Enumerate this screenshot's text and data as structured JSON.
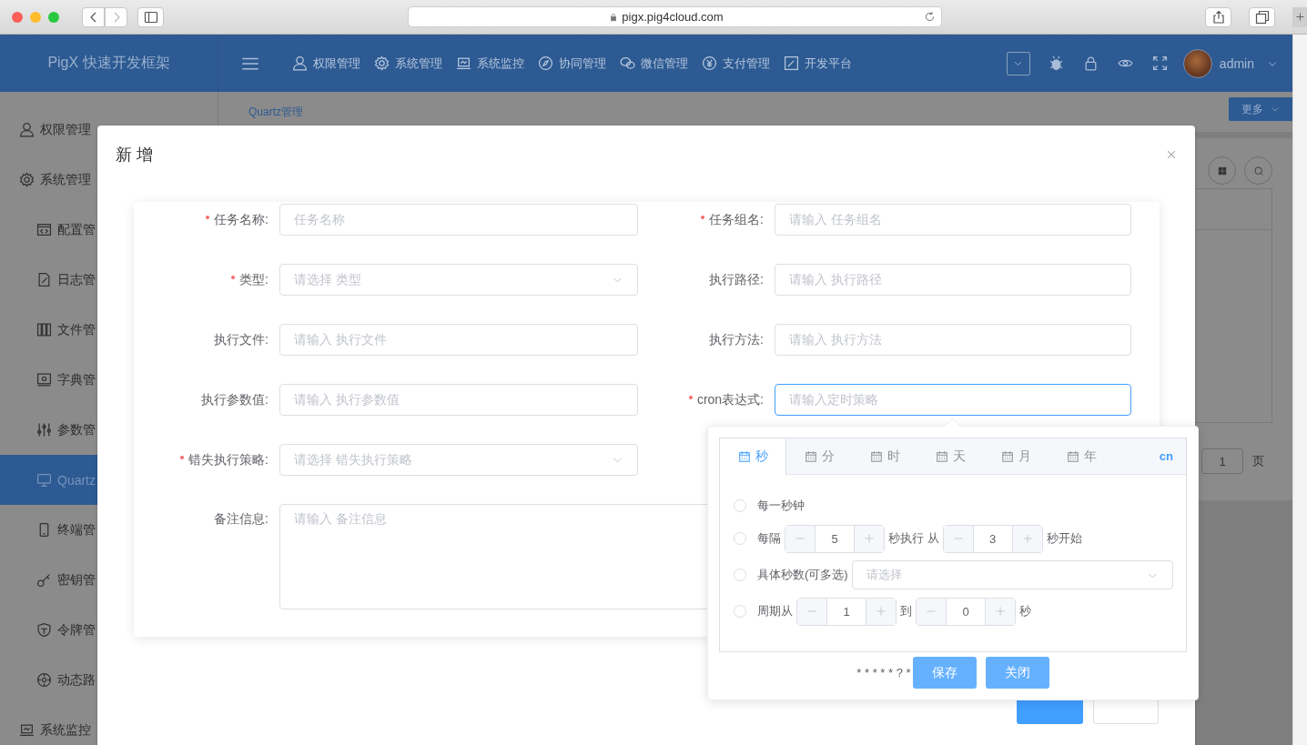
{
  "browser": {
    "url": "pigx.pig4cloud.com"
  },
  "header": {
    "logo": "PigX 快速开发框架",
    "nav": [
      {
        "label": "权限管理"
      },
      {
        "label": "系统管理"
      },
      {
        "label": "系统监控"
      },
      {
        "label": "协同管理"
      },
      {
        "label": "微信管理"
      },
      {
        "label": "支付管理"
      },
      {
        "label": "开发平台"
      }
    ],
    "user": "admin"
  },
  "sidebar": {
    "items": [
      {
        "label": "权限管理",
        "selected": false
      },
      {
        "label": "系统管理",
        "selected": false,
        "children": [
          {
            "label": "配置管",
            "selected": false
          },
          {
            "label": "日志管",
            "selected": false
          },
          {
            "label": "文件管",
            "selected": false
          },
          {
            "label": "字典管",
            "selected": false
          },
          {
            "label": "参数管",
            "selected": false
          },
          {
            "label": "Quartz",
            "selected": true
          },
          {
            "label": "终端管",
            "selected": false
          },
          {
            "label": "密钥管",
            "selected": false
          },
          {
            "label": "令牌管",
            "selected": false
          },
          {
            "label": "动态路",
            "selected": false
          }
        ]
      },
      {
        "label": "系统监控",
        "selected": false
      }
    ]
  },
  "content": {
    "tab": "Quartz管理",
    "more_button": "更多",
    "pager": {
      "page": "1",
      "suffix": "页"
    }
  },
  "dialog": {
    "title": "新 增",
    "fields": [
      {
        "label": "任务名称:",
        "required": true,
        "kind": "input",
        "placeholder": "任务名称",
        "focused": false
      },
      {
        "label": "任务组名:",
        "required": true,
        "kind": "input",
        "placeholder": "请输入 任务组名",
        "focused": false
      },
      {
        "label": "类型:",
        "required": true,
        "kind": "select",
        "placeholder": "请选择 类型",
        "focused": false
      },
      {
        "label": "执行路径:",
        "required": false,
        "kind": "input",
        "placeholder": "请输入 执行路径",
        "focused": false
      },
      {
        "label": "执行文件:",
        "required": false,
        "kind": "input",
        "placeholder": "请输入 执行文件",
        "focused": false
      },
      {
        "label": "执行方法:",
        "required": false,
        "kind": "input",
        "placeholder": "请输入 执行方法",
        "focused": false
      },
      {
        "label": "执行参数值:",
        "required": false,
        "kind": "input",
        "placeholder": "请输入 执行参数值",
        "focused": false
      },
      {
        "label": "cron表达式:",
        "required": true,
        "kind": "input",
        "placeholder": "请输入定时策略",
        "focused": true
      },
      {
        "label": "错失执行策略:",
        "required": true,
        "kind": "select",
        "placeholder": "请选择 错失执行策略",
        "focused": false
      },
      {
        "label": "备注信息:",
        "required": false,
        "kind": "textarea",
        "placeholder": "请输入 备注信息",
        "focused": false
      }
    ],
    "footer_buttons": [
      {
        "kind": "primary"
      },
      {
        "kind": "default"
      }
    ]
  },
  "cron_popover": {
    "tabs": [
      {
        "label": "秒",
        "selected": true
      },
      {
        "label": "分",
        "selected": false
      },
      {
        "label": "时",
        "selected": false
      },
      {
        "label": "天",
        "selected": false
      },
      {
        "label": "月",
        "selected": false
      },
      {
        "label": "年",
        "selected": false
      }
    ],
    "language": {
      "label": "cn",
      "on": true
    },
    "options": [
      {
        "selected": false,
        "items": [
          {
            "kind": "text",
            "text": "每一秒钟"
          }
        ]
      },
      {
        "selected": false,
        "items": [
          {
            "kind": "text",
            "text": "每隔"
          },
          {
            "kind": "number",
            "value": "5"
          },
          {
            "kind": "text",
            "text": "秒执行 从"
          },
          {
            "kind": "number",
            "value": "3"
          },
          {
            "kind": "text",
            "text": "秒开始"
          }
        ]
      },
      {
        "selected": false,
        "items": [
          {
            "kind": "text",
            "text": "具体秒数(可多选)"
          },
          {
            "kind": "select",
            "placeholder": "请选择"
          }
        ]
      },
      {
        "selected": false,
        "items": [
          {
            "kind": "text",
            "text": "周期从"
          },
          {
            "kind": "number",
            "value": "1"
          },
          {
            "kind": "text",
            "text": "到"
          },
          {
            "kind": "number",
            "value": "0"
          },
          {
            "kind": "text",
            "text": "秒"
          }
        ]
      }
    ],
    "expression": "* * * * * ? *",
    "buttons": [
      {
        "label": "保存"
      },
      {
        "label": "关闭"
      }
    ]
  }
}
